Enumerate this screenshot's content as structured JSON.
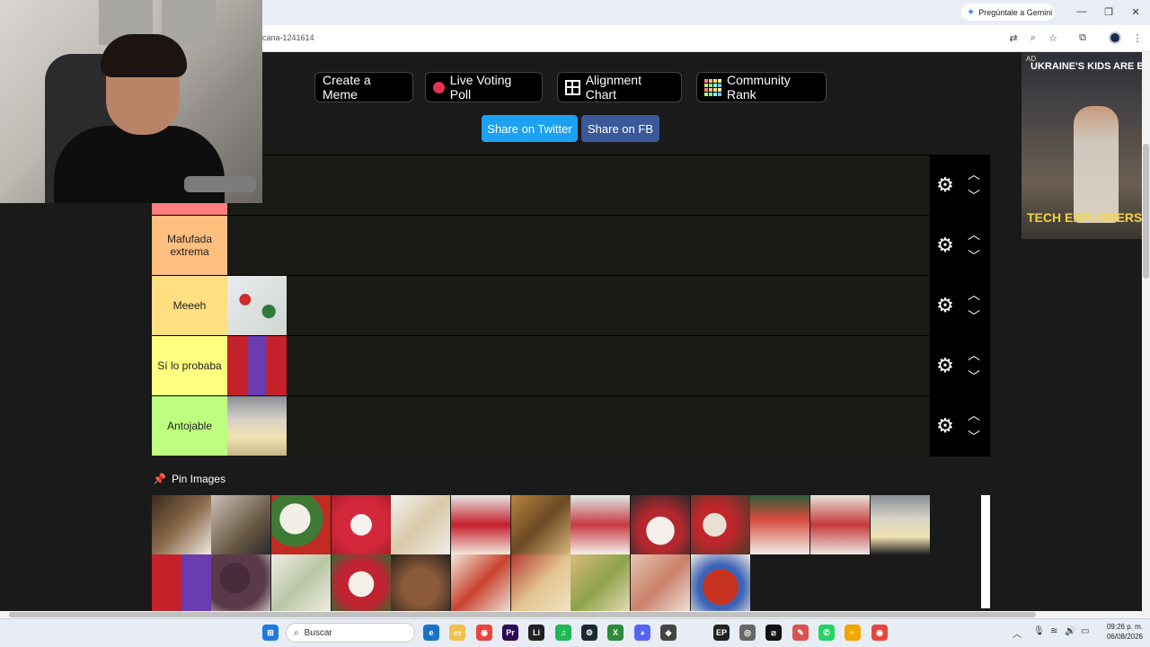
{
  "browser": {
    "gemini_button": "Pregúntale a Gemini",
    "url_fragment": "cana-1241614"
  },
  "page": {
    "buttons": {
      "create_meme": "Create a Meme",
      "live_poll": "Live Voting Poll",
      "alignment_chart": "Alignment Chart",
      "community_rank": "Community Rank",
      "share_twitter": "Share on Twitter",
      "share_fb": "Share on FB"
    },
    "tiers": [
      {
        "label": "",
        "color": "#ff7f7f"
      },
      {
        "label": "Mafufada extrema",
        "color": "#ffbf7f"
      },
      {
        "label": "Meeeh",
        "color": "#ffdf7f"
      },
      {
        "label": "Sí lo probaba",
        "color": "#ffff7f"
      },
      {
        "label": "Antojable",
        "color": "#bfff7f"
      }
    ],
    "pin_images_label": "Pin Images"
  },
  "ad": {
    "badge": "AD",
    "headline": "UKRAINE'S KIDS ARE BU",
    "subtitle": "TECH EXPLORERS"
  },
  "taskbar": {
    "search_placeholder": "Buscar",
    "time": "09:26 p. m.",
    "date": "06/08/2026"
  },
  "colors": {
    "twitter": "#1da1f2",
    "facebook": "#3b5998",
    "accent_record": "#e3344f"
  }
}
